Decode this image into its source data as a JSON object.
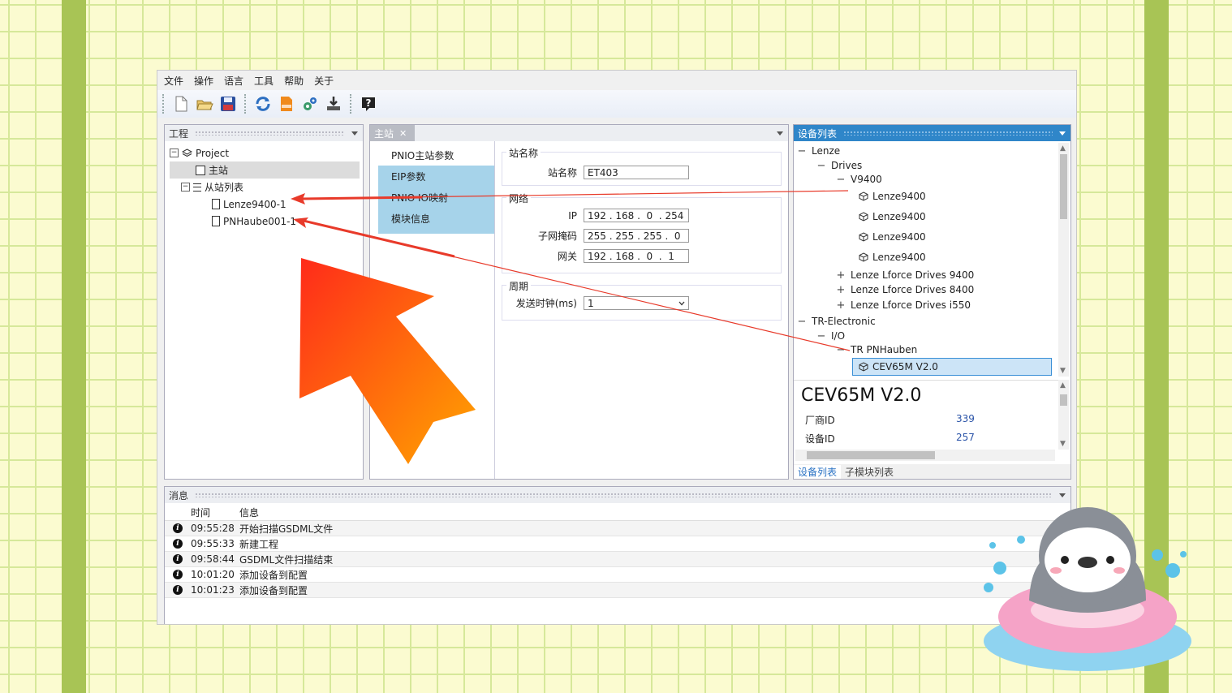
{
  "menu": [
    "文件",
    "操作",
    "语言",
    "工具",
    "帮助",
    "关于"
  ],
  "toolbar": [
    "new-file-icon",
    "open-folder-icon",
    "save-icon",
    "refresh-icon",
    "gsdml-file-icon",
    "settings-gears-icon",
    "download-icon",
    "help-icon"
  ],
  "project_panel": {
    "title": "工程",
    "tree": {
      "root": "Project",
      "master": "主站",
      "slave_list": "从站列表",
      "slaves": [
        "Lenze9400-1",
        "PNHaube001-1"
      ]
    }
  },
  "master_panel": {
    "tab_title": "主站",
    "close_symbol": "✕",
    "nav": [
      "PNIO主站参数",
      "EIP参数",
      "PNIO IO映射",
      "模块信息"
    ],
    "station": {
      "group": "站名称",
      "label": "站名称",
      "value": "ET403"
    },
    "network": {
      "group": "网络",
      "ip_label": "IP",
      "ip": [
        "192",
        "168",
        "0",
        "254"
      ],
      "mask_label": "子网掩码",
      "mask": [
        "255",
        "255",
        "255",
        "0"
      ],
      "gateway_label": "网关",
      "gateway": [
        "192",
        "168",
        "0",
        "1"
      ]
    },
    "cycle": {
      "group": "周期",
      "label": "发送时钟(ms)",
      "value": "1"
    }
  },
  "device_panel": {
    "title": "设备列表",
    "tree": {
      "lenze": "Lenze",
      "drives": "Drives",
      "v9400": "V9400",
      "lenze9400_items": [
        "Lenze9400",
        "Lenze9400",
        "Lenze9400",
        "Lenze9400"
      ],
      "lenze_families": [
        "Lenze Lforce Drives 9400",
        "Lenze Lforce Drives 8400",
        "Lenze Lforce Drives i550"
      ],
      "tr": "TR-Electronic",
      "io": "I/O",
      "tr_pnhauben": "TR PNHauben",
      "selected": "CEV65M V2.0"
    },
    "detail": {
      "title": "CEV65M V2.0",
      "vendor_label": "厂商ID",
      "vendor_value": "339",
      "device_label": "设备ID",
      "device_value": "257"
    },
    "tabs": [
      "设备列表",
      "子模块列表"
    ]
  },
  "messages": {
    "title": "消息",
    "headers": [
      "时间",
      "信息"
    ],
    "rows": [
      {
        "time": "09:55:28",
        "text": "开始扫描GSDML文件"
      },
      {
        "time": "09:55:33",
        "text": "新建工程"
      },
      {
        "time": "09:58:44",
        "text": "GSDML文件扫描结束"
      },
      {
        "time": "10:01:20",
        "text": "添加设备到配置"
      },
      {
        "time": "10:01:23",
        "text": "添加设备到配置"
      }
    ]
  },
  "colors": {
    "background": "#fbfbd0",
    "grid": "#d6e89a",
    "side_band": "#a8c455",
    "accent_blue": "#2f86c9",
    "nav_blue": "#a6d3ea",
    "arrow_red": "#e83a2a",
    "big_arrow_start": "#ff2a1a",
    "big_arrow_end": "#ffa500",
    "penguin_ring": "#f5a3c7"
  },
  "decorations": [
    "red-annotation-arrow",
    "big-orange-arrow",
    "penguin-sticker"
  ]
}
